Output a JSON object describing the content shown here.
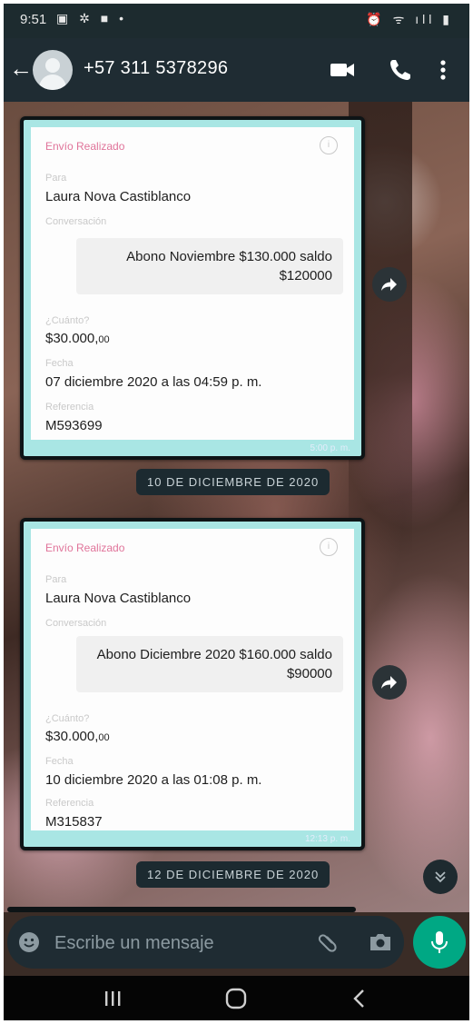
{
  "status_bar": {
    "time": "9:51",
    "left_icons": "▣ ✲ ■ •",
    "right_icons": "⏰ ᯤ ıll ▮"
  },
  "header": {
    "contact_name": "+57 311 5378296",
    "icons": [
      "back-arrow-icon",
      "avatar",
      "video-call-icon",
      "phone-icon",
      "more-options-icon"
    ]
  },
  "messages": [
    {
      "title": "Envío Realizado",
      "info_icon": "i",
      "para_label": "Para",
      "para_value": "Laura Nova Castiblanco",
      "conversacion_label": "Conversación",
      "conversacion_text": "Abono Noviembre $130.000 saldo $120000",
      "cuanto_label": "¿Cuánto?",
      "cuanto_value": "$30.000,",
      "cuanto_cents": "00",
      "fecha_label": "Fecha",
      "fecha_value": "07 diciembre 2020 a las 04:59 p. m.",
      "referencia_label": "Referencia",
      "referencia_value": "M593699",
      "time": "5:00 p. m."
    },
    {
      "title": "Envío Realizado",
      "info_icon": "i",
      "para_label": "Para",
      "para_value": "Laura Nova Castiblanco",
      "conversacion_label": "Conversación",
      "conversacion_text": "Abono Diciembre 2020 $160.000 saldo $90000",
      "cuanto_label": "¿Cuánto?",
      "cuanto_value": "$30.000,",
      "cuanto_cents": "00",
      "fecha_label": "Fecha",
      "fecha_value": "10 diciembre 2020 a las 01:08 p. m.",
      "referencia_label": "Referencia",
      "referencia_value": "M315837",
      "time": "12:13 p. m."
    }
  ],
  "date_chips": [
    "10 DE DICIEMBRE DE 2020",
    "12 DE DICIEMBRE DE 2020"
  ],
  "composer": {
    "placeholder": "Escribe un mensaje",
    "icons": [
      "emoji-icon",
      "attach-icon",
      "camera-icon",
      "mic-icon"
    ]
  },
  "colors": {
    "header_bg": "#1f2c33",
    "card_accent": "#a9e6e4",
    "card_title": "#e0749a",
    "mic_button": "#00a884"
  }
}
